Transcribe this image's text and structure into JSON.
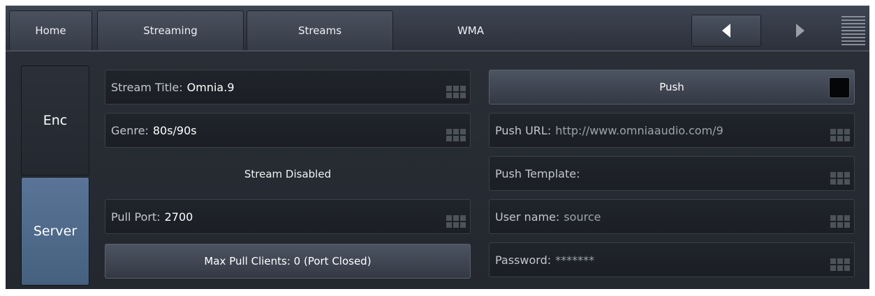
{
  "nav": {
    "home": "Home",
    "streaming": "Streaming",
    "streams": "Streams",
    "current": "WMA"
  },
  "side": {
    "enc": "Enc",
    "server": "Server"
  },
  "left": {
    "stream_title": {
      "key": "Stream Title:",
      "value": "Omnia.9"
    },
    "genre": {
      "key": "Genre:",
      "value": "80s/90s"
    },
    "status": "Stream Disabled",
    "pull_port": {
      "key": "Pull Port:",
      "value": "2700"
    },
    "max_pull_clients": "Max Pull Clients: 0 (Port Closed)"
  },
  "right": {
    "push_label": "Push",
    "push_url": {
      "key": "Push URL:",
      "value": "http://www.omniaaudio.com/9"
    },
    "push_template": {
      "key": "Push Template:",
      "value": ""
    },
    "user_name": {
      "key": "User name:",
      "value": "source"
    },
    "password": {
      "key": "Password:",
      "value": "*******"
    }
  },
  "colors": {
    "panel_bg": "#262a31",
    "selected_tab": "#4f6a8c",
    "field_bg": "#1e2127",
    "text": "#ffffff"
  },
  "icons": {
    "prev": "triangle-left-icon",
    "next": "triangle-right-icon",
    "menu": "menu-lines-icon",
    "field_grip": "grid-grip-icon",
    "push_indicator": "square-indicator-icon"
  }
}
